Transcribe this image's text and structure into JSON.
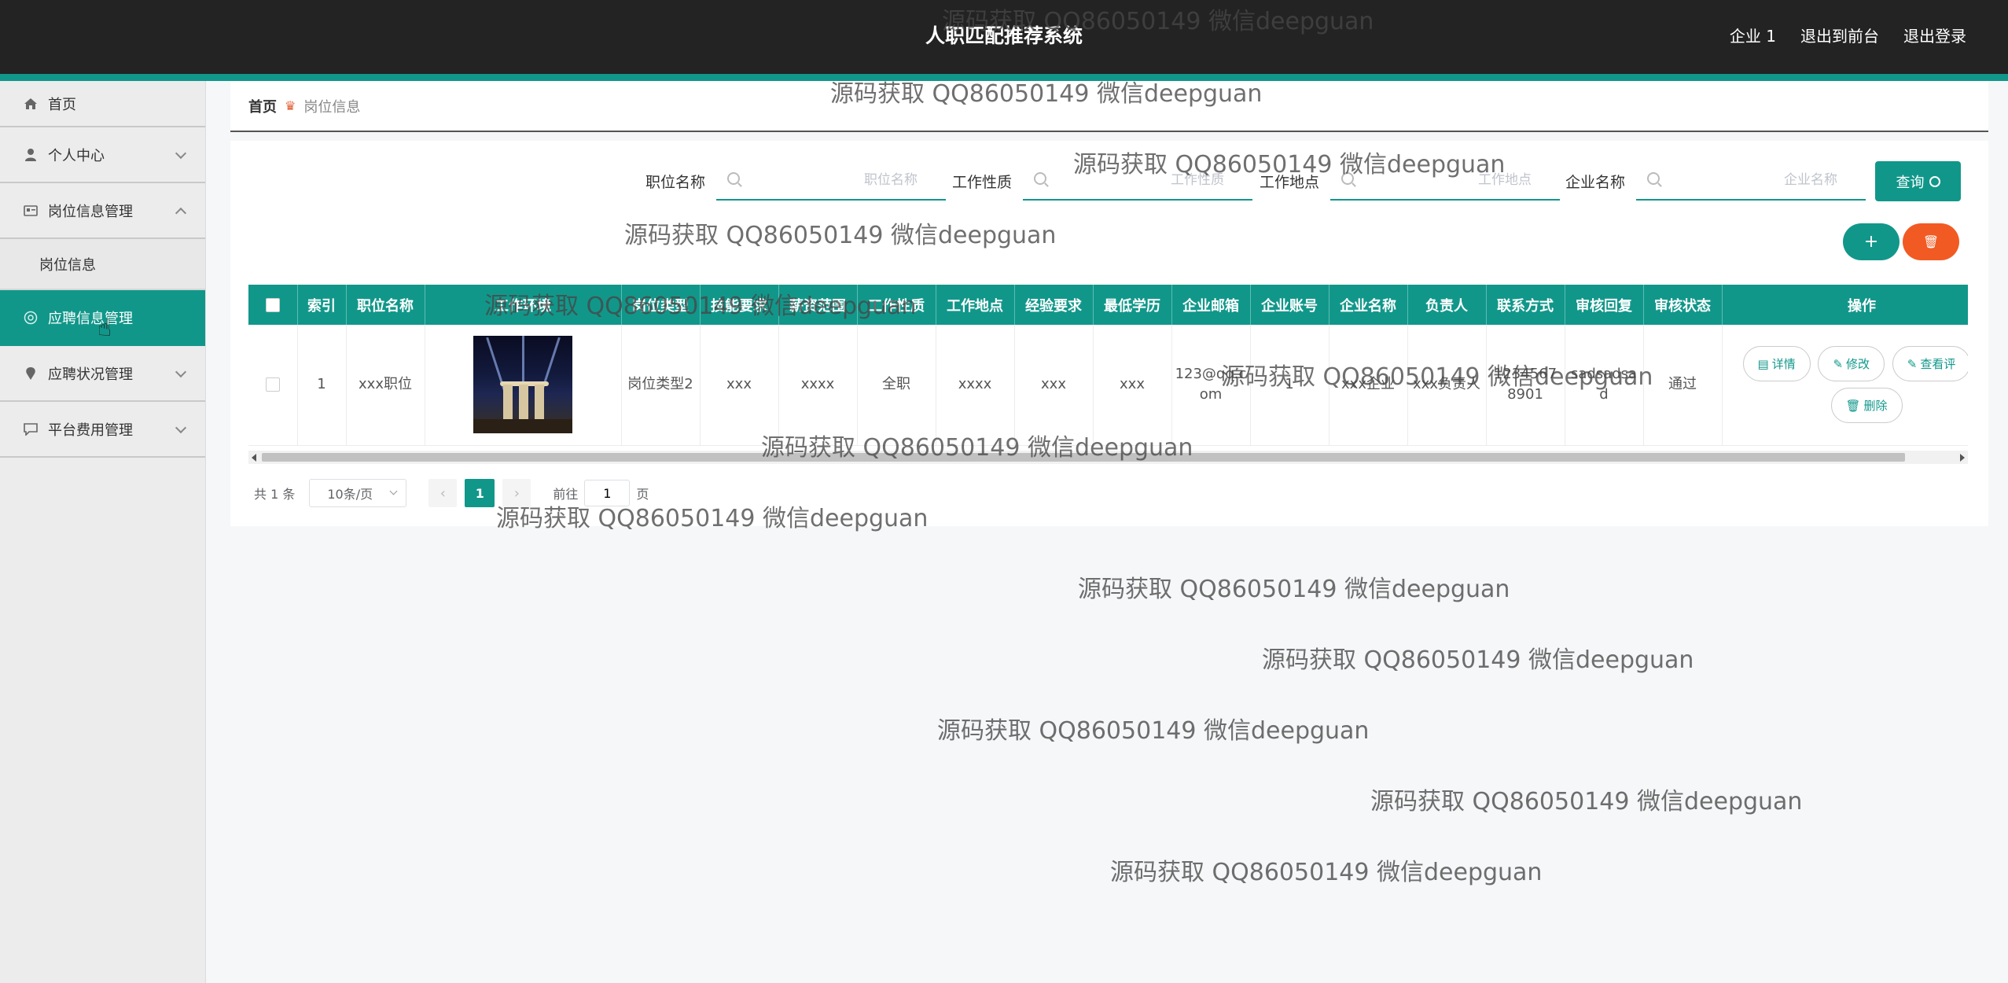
{
  "header": {
    "title": "人职匹配推荐系统",
    "links": [
      "企业 1",
      "退出到前台",
      "退出登录"
    ]
  },
  "sidebar": {
    "items": [
      {
        "label": "首页",
        "icon": "home-icon"
      },
      {
        "label": "个人中心",
        "icon": "user-icon"
      },
      {
        "label": "岗位信息管理",
        "icon": "card-icon"
      },
      {
        "label": "岗位信息",
        "icon": ""
      },
      {
        "label": "应聘信息管理",
        "icon": "target-icon"
      },
      {
        "label": "应聘状况管理",
        "icon": "pin-icon"
      },
      {
        "label": "平台费用管理",
        "icon": "chat-icon"
      }
    ]
  },
  "breadcrumb": {
    "home": "首页",
    "current": "岗位信息"
  },
  "search": {
    "fields": [
      {
        "label": "职位名称",
        "placeholder": "职位名称"
      },
      {
        "label": "工作性质",
        "placeholder": "工作性质"
      },
      {
        "label": "工作地点",
        "placeholder": "工作地点"
      },
      {
        "label": "企业名称",
        "placeholder": "企业名称"
      }
    ],
    "button": "查询"
  },
  "actions": {
    "add": "+",
    "delete": "🗑"
  },
  "table": {
    "headers": [
      "索引",
      "职位名称",
      "工作环境",
      "岗位类型",
      "技能要求",
      "薪资范围",
      "工作性质",
      "工作地点",
      "经验要求",
      "最低学历",
      "企业邮箱",
      "企业账号",
      "企业名称",
      "负责人",
      "联系方式",
      "审核回复",
      "审核状态",
      "操作"
    ],
    "rows": [
      {
        "index": "1",
        "name": "xxx职位",
        "type": "岗位类型2",
        "skill": "xxx",
        "salary": "xxxx",
        "nature": "全职",
        "location": "xxxx",
        "experience": "xxx",
        "education": "xxx",
        "email": "123@qq.com",
        "account": "1",
        "company": "xxx企业",
        "manager": "xxx负责人",
        "phone": "12345678901",
        "reply": "sadsadsad",
        "status": "通过"
      }
    ],
    "ops": [
      "详情",
      "修改",
      "查看评",
      "删除"
    ]
  },
  "pagination": {
    "total": "共 1 条",
    "size": "10条/页",
    "page": "1",
    "goto": "前往",
    "goto_value": "1",
    "page_unit": "页"
  },
  "watermark": "源码获取 QQ86050149 微信deepguan"
}
